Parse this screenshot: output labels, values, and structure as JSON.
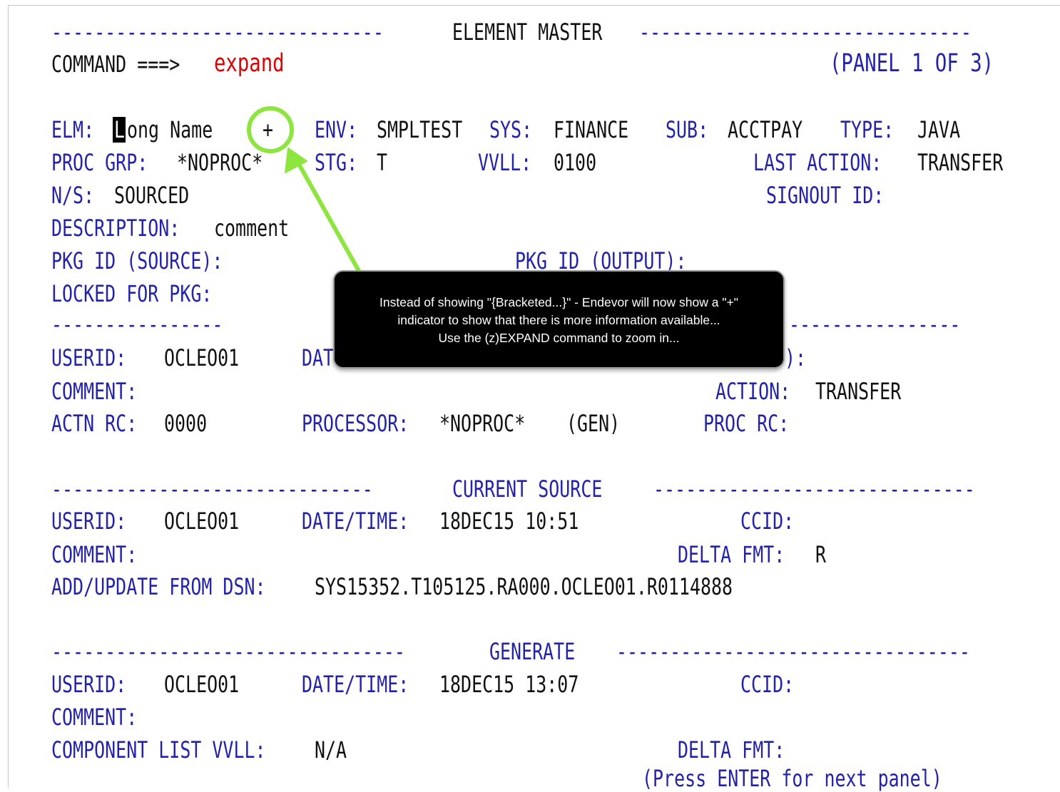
{
  "panel": {
    "title": "ELEMENT MASTER",
    "command_label": "COMMAND ===>",
    "command_value": "expand",
    "panel_indicator": "(PANEL 1 OF 3)"
  },
  "element": {
    "elm_label": "ELM:",
    "elm_cursor_char": "L",
    "elm_value": "ong Name",
    "more_indicator": "+",
    "env_label": "ENV:",
    "env_value": "SMPLTEST",
    "sys_label": "SYS:",
    "sys_value": "FINANCE",
    "sub_label": "SUB:",
    "sub_value": "ACCTPAY",
    "type_label": "TYPE:",
    "type_value": "JAVA",
    "procgrp_label": "PROC GRP:",
    "procgrp_value": "*NOPROC*",
    "stg_label": "STG:",
    "stg_value": "T",
    "vvll_label": "VVLL:",
    "vvll_value": "0100",
    "last_action_label": "LAST ACTION:",
    "last_action_value": "TRANSFER",
    "ns_label": "N/S:",
    "ns_value": "SOURCED",
    "signout_label": "SIGNOUT ID:",
    "desc_label": "DESCRIPTION:",
    "desc_value": "comment",
    "pkg_source_label": "PKG ID (SOURCE):",
    "pkg_output_label": "PKG ID (OUTPUT):",
    "locked_label": "LOCKED FOR PKG:"
  },
  "last_action": {
    "userid_label": "USERID:",
    "userid_value": "OCLEO01",
    "datetime_label_partial": "DAT",
    "ccid_label_partial": "):",
    "comment_label": "COMMENT:",
    "action_label": "ACTION:",
    "action_value": "TRANSFER",
    "actn_rc_label": "ACTN RC:",
    "actn_rc_value": "0000",
    "processor_label": "PROCESSOR:",
    "processor_value": "*NOPROC*",
    "processor_gen": "(GEN)",
    "proc_rc_label": "PROC RC:"
  },
  "current_source": {
    "title": "CURRENT SOURCE",
    "userid_label": "USERID:",
    "userid_value": "OCLEO01",
    "datetime_label": "DATE/TIME:",
    "datetime_value": "18DEC15 10:51",
    "ccid_label": "CCID:",
    "comment_label": "COMMENT:",
    "delta_fmt_label": "DELTA FMT:",
    "delta_fmt_value": "R",
    "dsn_label": "ADD/UPDATE FROM DSN:",
    "dsn_value": "SYS15352.T105125.RA000.OCLEO01.R0114888"
  },
  "generate": {
    "title": "GENERATE",
    "userid_label": "USERID:",
    "userid_value": "OCLEO01",
    "datetime_label": "DATE/TIME:",
    "datetime_value": "18DEC15 13:07",
    "ccid_label": "CCID:",
    "comment_label": "COMMENT:",
    "complist_label": "COMPONENT LIST VVLL:",
    "complist_value": "N/A",
    "delta_fmt_label": "DELTA FMT:",
    "press_enter": "(Press ENTER for next panel)"
  },
  "callout": {
    "line1": "Instead of showing \"{Bracketed...}\" - Endevor will now show a \"+\"",
    "line2": "indicator to show that there is more information available...",
    "line3": "Use the (z)EXPAND command to zoom in..."
  },
  "colors": {
    "label_blue": "#2222aa",
    "value_black": "#111111",
    "command_red": "#e00000",
    "highlight_green": "#8ee53f"
  }
}
